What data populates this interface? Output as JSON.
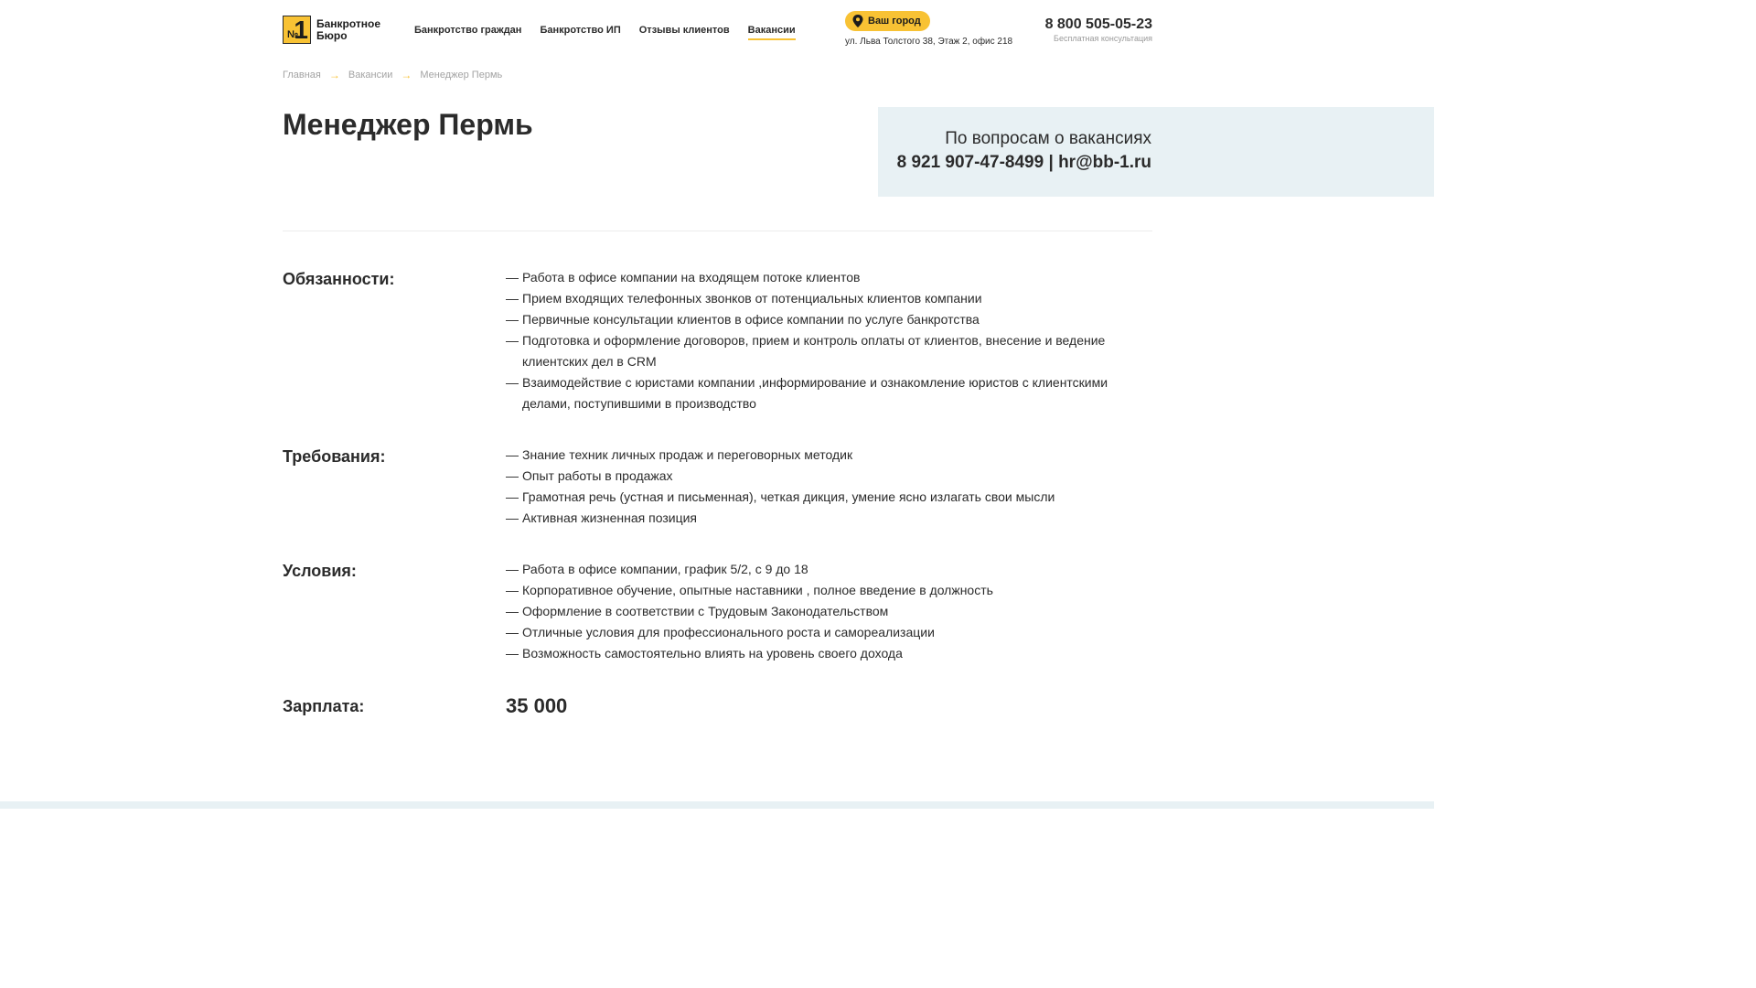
{
  "header": {
    "logo": {
      "mark_no": "№",
      "mark_one": "1",
      "line1": "Банкротное",
      "line2": "Бюро"
    },
    "nav": [
      {
        "label": "Банкротство граждан",
        "active": false
      },
      {
        "label": "Банкротство ИП",
        "active": false
      },
      {
        "label": "Отзывы клиентов",
        "active": false
      },
      {
        "label": "Вакансии",
        "active": true
      }
    ],
    "city_button": "Ваш город",
    "address": "ул. Льва Толстого 38, Этаж 2, офис 218",
    "phone": "8 800 505-05-23",
    "phone_note": "Бесплатная консультация"
  },
  "breadcrumb": [
    "Главная",
    "Вакансии",
    "Менеджер Пермь"
  ],
  "page_title": "Менеджер Пермь",
  "contact": {
    "question": "По вопросам о вакансиях",
    "phone": "8 921 907-47-8499",
    "separator": "|",
    "email": "hr@bb-1.ru"
  },
  "sections": {
    "duties": {
      "label": "Обязанности:",
      "items": [
        "Работа в офисе компании на входящем потоке клиентов",
        "Прием входящих телефонных звонков от потенциальных клиентов компании",
        "Первичные консультации клиентов в офисе компании по услуге банкротства",
        "Подготовка и оформление договоров, прием и контроль оплаты от клиентов, внесение и ведение клиентских дел в CRM",
        "Взаимодействие с юристами компании ,информирование и ознакомление юристов с клиентскими делами, поступившими в производство"
      ]
    },
    "requirements": {
      "label": "Требования:",
      "items": [
        "Знание техник личных продаж и переговорных методик",
        "Опыт работы в продажах",
        "Грамотная речь (устная и письменная), четкая дикция, умение ясно излагать свои мысли",
        "Активная жизненная позиция"
      ]
    },
    "conditions": {
      "label": "Условия:",
      "items": [
        "Работа в офисе компании, график 5/2, с 9 до 18",
        "Корпоративное обучение, опытные наставники , полное введение в должность",
        "Оформление в соответствии с Трудовым Законодательством",
        "Отличные условия для профессионального роста и самореализации",
        "Возможность самостоятельно влиять на уровень своего дохода"
      ]
    }
  },
  "salary": {
    "label": "Зарплата:",
    "value": "35 000"
  },
  "dash": "—",
  "colors": {
    "accent": "#f8c234",
    "panel": "#e8f1f4",
    "text": "#2b2b2b"
  }
}
